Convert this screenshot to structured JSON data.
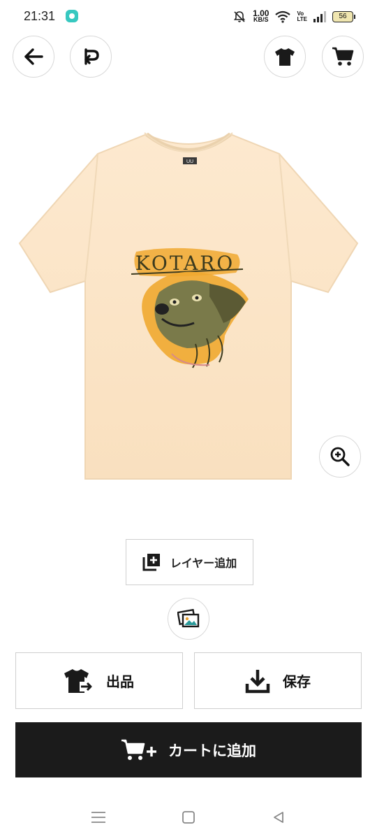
{
  "status_bar": {
    "time": "21:31",
    "net_speed_value": "1.00",
    "net_speed_unit": "KB/S",
    "volte_top": "Vo",
    "volte_bottom": "LTE",
    "battery": "56"
  },
  "toolbar": {
    "back_icon": "arrow-left-icon",
    "redo_icon": "redo-icon",
    "tshirt_icon": "tshirt-icon",
    "cart_icon": "cart-icon"
  },
  "product": {
    "shirt_color": "#fbe6c9",
    "design_text": "KOTARO",
    "design_accent": "#f0a830"
  },
  "layer": {
    "add_label": "レイヤー追加"
  },
  "actions": {
    "listing_label": "出品",
    "save_label": "保存",
    "cart_add_label": "カートに追加"
  }
}
